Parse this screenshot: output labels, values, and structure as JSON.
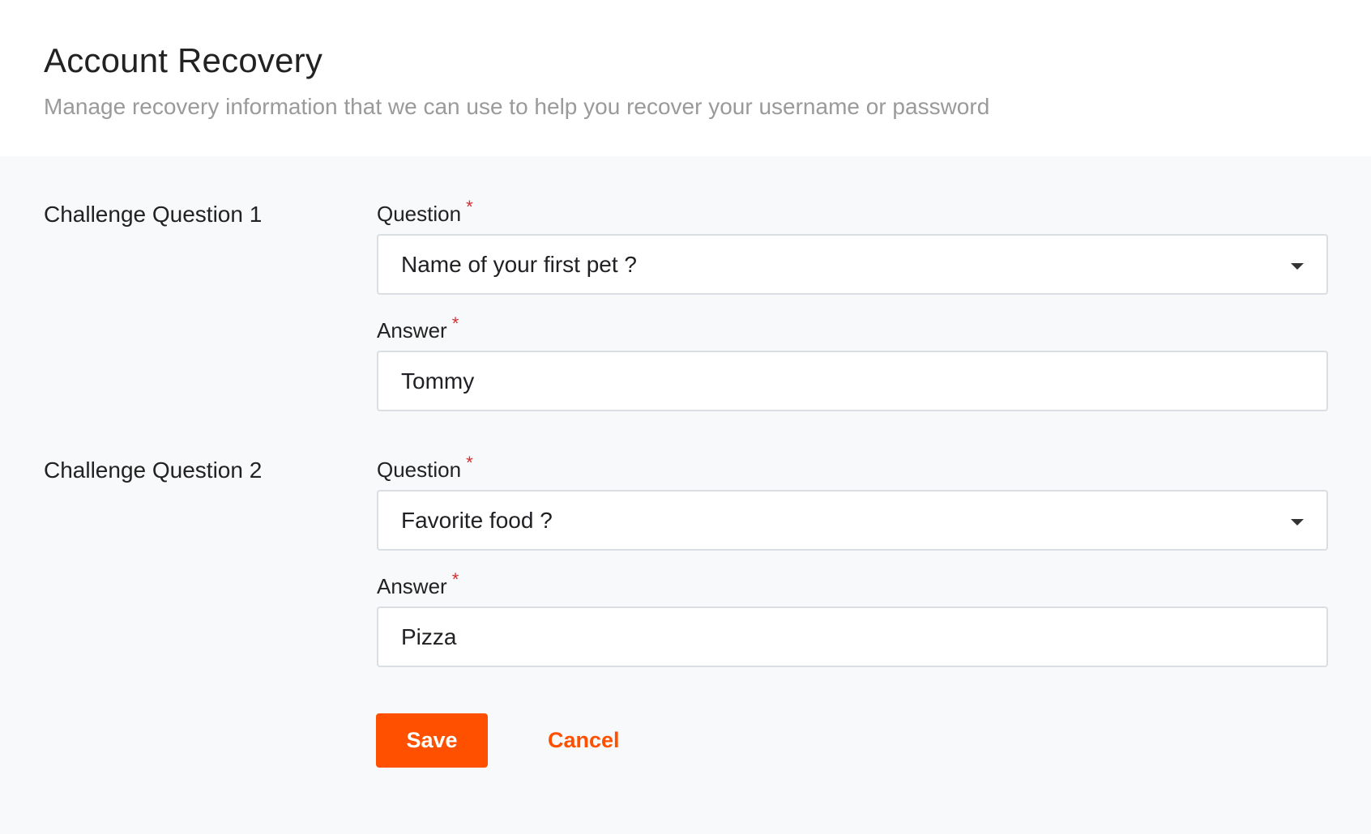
{
  "header": {
    "title": "Account Recovery",
    "subtitle": "Manage recovery information that we can use to help you recover your username or password"
  },
  "challenges": [
    {
      "section_label": "Challenge Question 1",
      "question_label": "Question",
      "question_value": "Name of your first pet ?",
      "answer_label": "Answer",
      "answer_value": "Tommy"
    },
    {
      "section_label": "Challenge Question 2",
      "question_label": "Question",
      "question_value": "Favorite food ?",
      "answer_label": "Answer",
      "answer_value": "Pizza"
    }
  ],
  "required_marker": "*",
  "actions": {
    "save_label": "Save",
    "cancel_label": "Cancel"
  },
  "colors": {
    "accent": "#ff5000",
    "required": "#d32f2f",
    "content_background": "#f8f9fa"
  },
  "icons": {
    "dropdown": "caret-down-icon"
  }
}
